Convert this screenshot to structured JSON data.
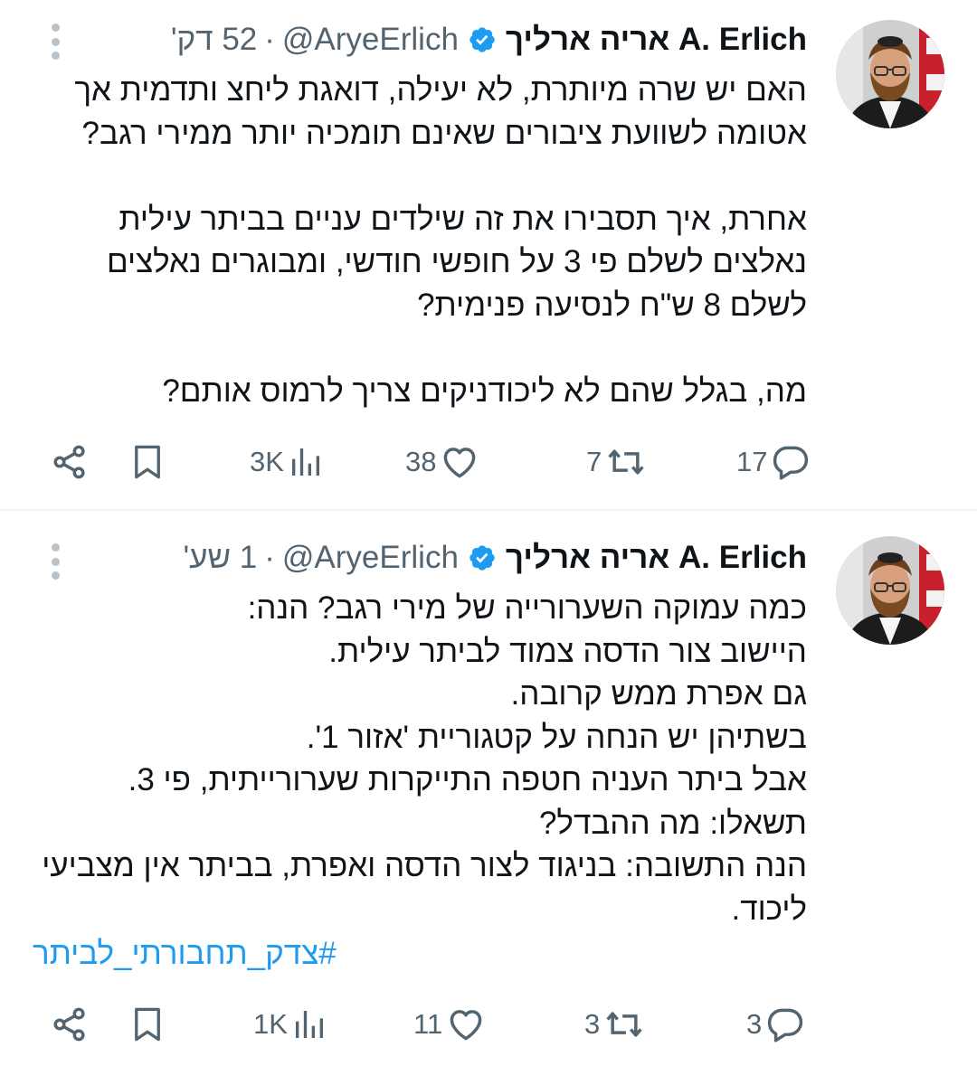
{
  "colors": {
    "text": "#0f1419",
    "secondary": "#536471",
    "accent": "#1d9bf0",
    "divider": "#eff3f4",
    "verified": "#1d9bf0"
  },
  "tweets": [
    {
      "author": {
        "display_name": "אריה ארליך A. Erlich",
        "handle": "@AryeErlich",
        "verified": true
      },
      "separator": "·",
      "time": "52 דק'",
      "text_lines": [
        "האם יש שרה מיותרת, לא יעילה, דואגת ליחצ ותדמית אך",
        "אטומה לשוועת ציבורים שאינם תומכיה יותר ממירי רגב?",
        "",
        "אחרת, איך תסבירו את זה שילדים עניים בביתר עילית",
        "נאלצים לשלם פי 3 על חופשי חודשי, ומבוגרים נאלצים",
        "לשלם 8 ש\"ח לנסיעה פנימית?",
        "",
        "מה, בגלל שהם לא ליכודניקים צריך לרמוס אותם?"
      ],
      "stats": {
        "replies": "17",
        "retweets": "7",
        "likes": "38",
        "views": "3K"
      },
      "icons": [
        "reply-icon",
        "retweet-icon",
        "like-icon",
        "views-icon",
        "bookmark-icon",
        "share-icon",
        "more-icon",
        "verified-icon"
      ]
    },
    {
      "author": {
        "display_name": "אריה ארליך A. Erlich",
        "handle": "@AryeErlich",
        "verified": true
      },
      "separator": "·",
      "time": "1 שע'",
      "text_lines": [
        "כמה עמוקה השערורייה של מירי רגב? הנה:",
        "היישוב צור הדסה צמוד לביתר עילית.",
        "גם אפרת ממש קרובה.",
        "בשתיהן יש הנחה על קטגוריית 'אזור 1'.",
        "אבל ביתר העניה חטפה התייקרות שערורייתית, פי 3.",
        "תשאלו: מה ההבדל?",
        "הנה התשובה: בניגוד לצור הדסה ואפרת, בביתר אין מצביעי",
        "ליכוד."
      ],
      "hashtag": "#צדק_תחבורתי_לביתר",
      "stats": {
        "replies": "3",
        "retweets": "3",
        "likes": "11",
        "views": "1K"
      },
      "icons": [
        "reply-icon",
        "retweet-icon",
        "like-icon",
        "views-icon",
        "bookmark-icon",
        "share-icon",
        "more-icon",
        "verified-icon"
      ]
    }
  ]
}
